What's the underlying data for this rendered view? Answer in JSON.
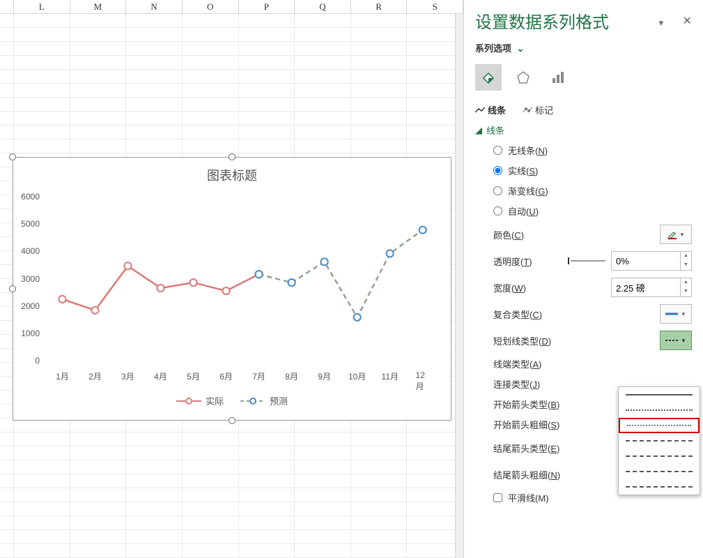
{
  "columns": [
    "L",
    "M",
    "N",
    "O",
    "P",
    "Q",
    "R",
    "S"
  ],
  "chart": {
    "title": "图表标题",
    "legend": {
      "actual": "实际",
      "forecast": "预测"
    },
    "categories": [
      "1月",
      "2月",
      "3月",
      "4月",
      "5月",
      "6月",
      "7月",
      "8月",
      "9月",
      "10月",
      "11月",
      "12月"
    ],
    "y_ticks": [
      0,
      1000,
      2000,
      3000,
      4000,
      5000,
      6000
    ]
  },
  "chart_data": {
    "type": "line",
    "categories": [
      "1月",
      "2月",
      "3月",
      "4月",
      "5月",
      "6月",
      "7月",
      "8月",
      "9月",
      "10月",
      "11月",
      "12月"
    ],
    "series": [
      {
        "name": "实际",
        "values": [
          2300,
          1900,
          3500,
          2700,
          2900,
          2600,
          3200,
          null,
          null,
          null,
          null,
          null
        ],
        "style": "solid",
        "color": "#d97b7b"
      },
      {
        "name": "预测",
        "values": [
          null,
          null,
          null,
          null,
          null,
          null,
          3200,
          2900,
          3650,
          1650,
          3950,
          4800
        ],
        "style": "dash",
        "color": "#8fa58f"
      }
    ],
    "title": "图表标题",
    "xlabel": "",
    "ylabel": "",
    "ylim": [
      0,
      6000
    ]
  },
  "panel": {
    "title": "设置数据系列格式",
    "series_options": "系列选项",
    "tab_line": "线条",
    "tab_marker": "标记",
    "section_line": "线条",
    "radios": {
      "none": "无线条(",
      "none_u": "N",
      "solid": "实线(",
      "solid_u": "S",
      "gradient": "渐变线(",
      "gradient_u": "G",
      "auto": "自动(",
      "auto_u": "U"
    },
    "color_label": "颜色(",
    "color_u": "C",
    "opacity_label": "透明度(",
    "opacity_u": "T",
    "opacity_value": "0%",
    "width_label": "宽度(",
    "width_u": "W",
    "width_value": "2.25 磅",
    "compound_label": "复合类型(",
    "compound_u": "C",
    "dash_label": "短划线类型(",
    "dash_u": "D",
    "cap_label": "线端类型(",
    "cap_u": "A",
    "join_label": "连接类型(",
    "join_u": "J",
    "begin_arrow_type": "开始箭头类型(",
    "begin_arrow_type_u": "B",
    "begin_arrow_size": "开始箭头粗细(",
    "begin_arrow_size_u": "S",
    "end_arrow_type": "结尾箭头类型(",
    "end_arrow_type_u": "E",
    "end_arrow_size": "结尾箭头粗细(",
    "end_arrow_size_u": "N",
    "smooth": "平滑线(",
    "smooth_u": "M",
    "close_paren": ")"
  }
}
